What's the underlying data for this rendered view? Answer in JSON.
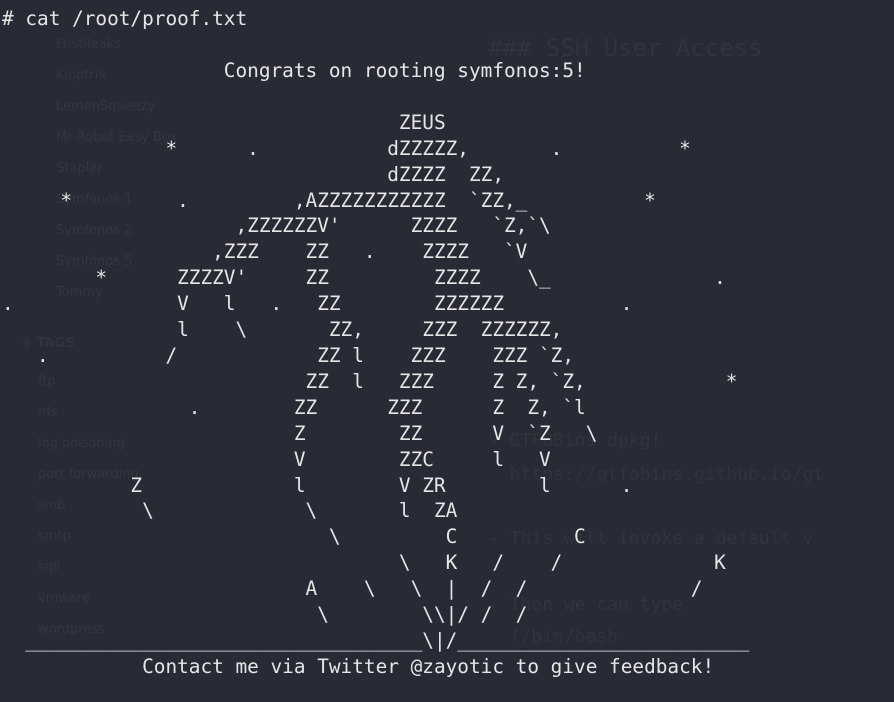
{
  "terminal": {
    "prompt": "#",
    "command": "cat /root/proof.txt",
    "command_line": "# cat /root/proof.txt",
    "proof_lines": [
      "                   Congrats on rooting symfonos:5!",
      "",
      "                                  ZEUS",
      "              *      .           dZZZZZ,       .          *",
      "                                 dZZZZ  ZZ,",
      "     *         .         ,AZZZZZZZZZZZ  `ZZ,_          *",
      "                    ,ZZZZZZV'      ZZZZ   `Z,`\\",
      "                  ,ZZZ    ZZ   .    ZZZZ   `V",
      "        *      ZZZZV'     ZZ         ZZZZ    \\_              .",
      ".              V   l   .   ZZ        ZZZZZZ          .",
      "               l    \\       ZZ,     ZZZ  ZZZZZZ,",
      "   .          /            ZZ l    ZZZ    ZZZ `Z,",
      "                          ZZ  l   ZZZ     Z Z, `Z,            *",
      "                .        ZZ      ZZZ      Z  Z, `l",
      "                         Z        ZZ      V  `Z   \\",
      "                         V        ZZC     l   V",
      "           Z             l        V ZR        l      .",
      "            \\             \\       l  ZA",
      "                            \\         C          C",
      "                                  \\   K   /    /             K",
      "                          A    \\   \\  |  /  /              /",
      "                           \\        \\\\|/ /  /",
      "  __________________________________\\|/_________________________",
      "            Contact me via Twitter @zayotic to give feedback!"
    ]
  },
  "background_page": {
    "heading": "### SSH User Access",
    "sidebar_items": [
      "Fristileaks",
      "Kioptrix",
      "LemonSqueezy",
      "Mr-Robot Easy Box",
      "Stapler",
      "Symfonos 1",
      "Symfonos 2",
      "Symfonos 5",
      "Tommy"
    ],
    "tags_label": "TAGS",
    "tag_items": [
      "ftp",
      "nfs",
      "log poisoning",
      "port forwarding",
      "smb",
      "smtp",
      "sqli",
      "vmware",
      "wordpress"
    ],
    "code_lines": [
      "- GTFOBins dpkg!",
      "  https://gtfobins.github.io/gt",
      "- This will invoke a default v",
      "- Then we can type",
      "  !/bin/bash"
    ]
  },
  "colors": {
    "background": "#282a36",
    "foreground": "#e6e6e6",
    "ghost_text": "#34363f"
  }
}
